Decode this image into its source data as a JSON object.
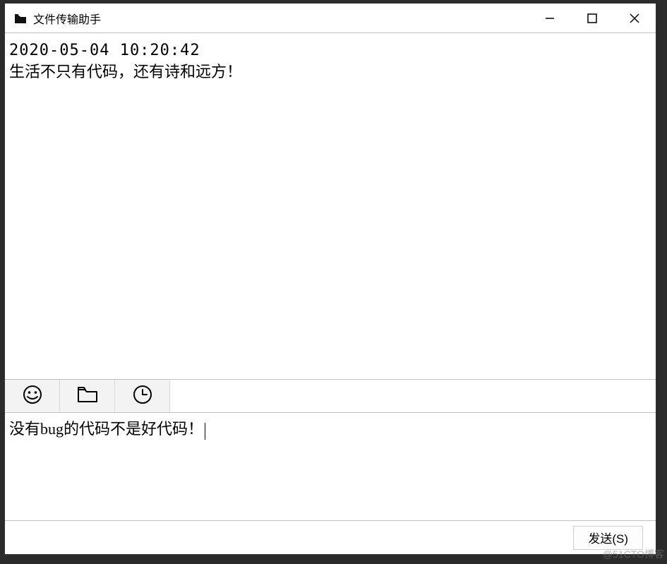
{
  "titlebar": {
    "title": "文件传输助手"
  },
  "messages": [
    {
      "timestamp": "2020-05-04 10:20:42",
      "text": "生活不只有代码，还有诗和远方！"
    }
  ],
  "toolbar": {
    "icons": [
      "emoji-icon",
      "folder-icon",
      "history-icon"
    ]
  },
  "input": {
    "value": "没有bug的代码不是好代码！"
  },
  "footer": {
    "send_label": "发送(S)"
  },
  "watermark": "@51CTO博客"
}
